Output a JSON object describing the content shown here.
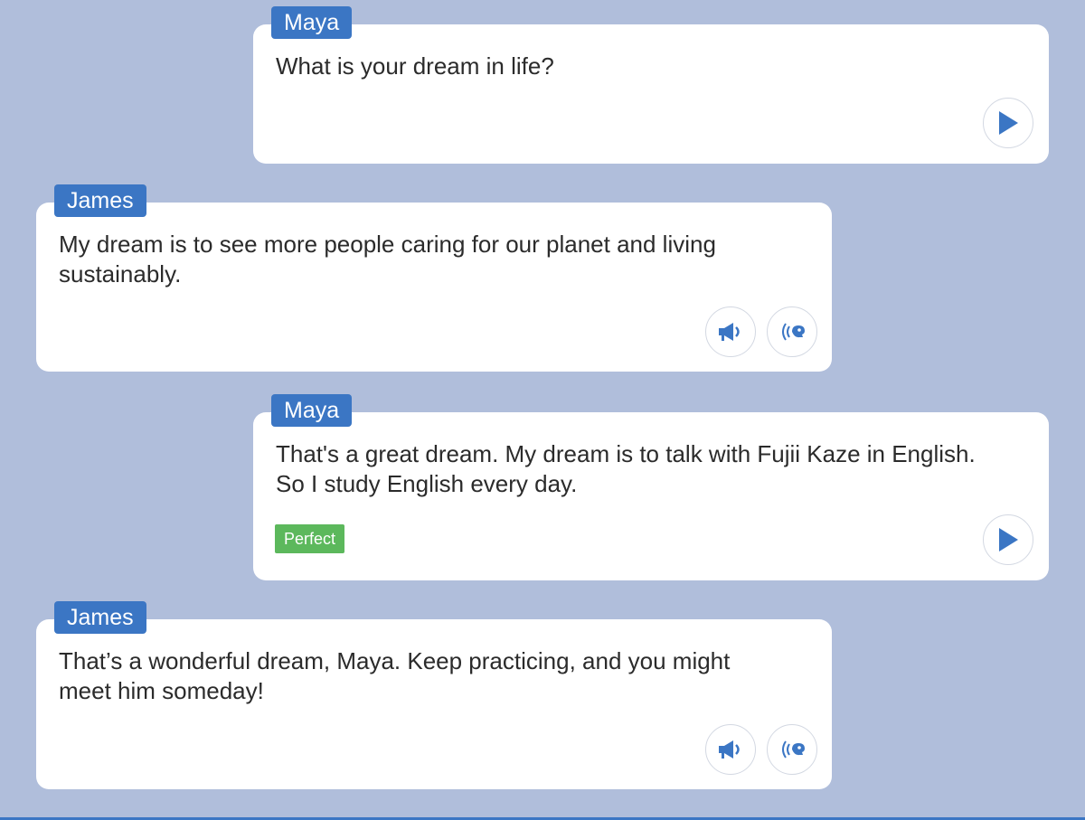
{
  "colors": {
    "background": "#b0bedb",
    "name_tag": "#3b76c4",
    "icon": "#3b76c4",
    "perfect_badge": "#5cb85c"
  },
  "messages": [
    {
      "speaker": "Maya",
      "text": "What is your dream in life?",
      "buttons": [
        "play-icon"
      ]
    },
    {
      "speaker": "James",
      "text": "My dream is to see more people caring for our planet and living sustainably.",
      "buttons": [
        "megaphone-icon",
        "speaking-head-icon"
      ]
    },
    {
      "speaker": "Maya",
      "text": "That's a great dream. My dream is to talk with Fujii Kaze in English. So I study English every day.",
      "badge": "Perfect",
      "buttons": [
        "play-icon"
      ]
    },
    {
      "speaker": "James",
      "text": "That’s a wonderful dream, Maya. Keep practicing, and you might meet him someday!",
      "buttons": [
        "megaphone-icon",
        "speaking-head-icon"
      ]
    }
  ]
}
